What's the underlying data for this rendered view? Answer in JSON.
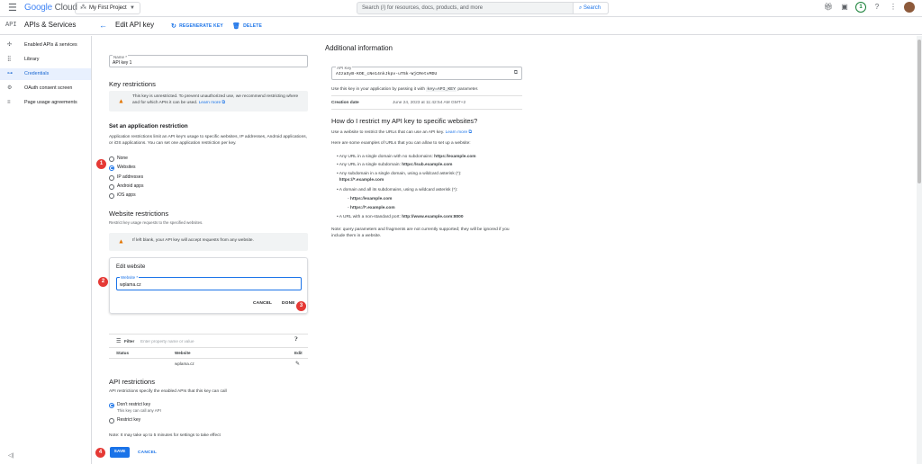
{
  "topbar": {
    "logo_google": "Google",
    "logo_cloud": "Cloud",
    "project": "My First Project",
    "search_placeholder": "Search (/) for resources, docs, products, and more",
    "search_button": "Search",
    "badge": "1"
  },
  "subbar": {
    "api_mark": "API",
    "section": "APIs & Services",
    "title": "Edit API key",
    "regenerate": "REGENERATE KEY",
    "delete": "DELETE"
  },
  "sidebar": {
    "items": [
      {
        "icon": "✣",
        "label": "Enabled APIs & services"
      },
      {
        "icon": "⣿",
        "label": "Library"
      },
      {
        "icon": "⊶",
        "label": "Credentials"
      },
      {
        "icon": "⚙",
        "label": "OAuth consent screen"
      },
      {
        "icon": "≡",
        "label": "Page usage agreements"
      }
    ],
    "collapse": "◁|"
  },
  "form": {
    "name_label": "Name *",
    "name_value": "API key 1",
    "key_restrictions": "Key restrictions",
    "unrestricted_warning": "This key is unrestricted. To prevent unauthorized use, we recommend restricting where and for which APIs it can be used.",
    "learn_more": "Learn more",
    "app_restriction_title": "Set an application restriction",
    "app_restriction_desc": "Application restrictions limit an API key's usage to specific websites, IP addresses, Android applications, or iOS applications. You can set one application restriction per key.",
    "options": [
      "None",
      "Websites",
      "IP addresses",
      "Android apps",
      "iOS apps"
    ],
    "selected_option": "Websites",
    "website_restrictions_title": "Website restrictions",
    "website_restrictions_desc": "Restrict key usage requests to the specified websites.",
    "blank_warning": "If left blank, your API key will accept requests from any website.",
    "edit_website": "Edit website",
    "website_label": "Website *",
    "website_value": "wplama.cz",
    "cancel": "CANCEL",
    "done": "DONE",
    "filter_label": "Filter",
    "filter_placeholder": "Enter property name or value",
    "col_status": "Status",
    "col_website": "Website",
    "col_edit": "Edit",
    "row_website": "wplama.cz",
    "api_restrictions_title": "API restrictions",
    "api_restrictions_desc": "API restrictions specify the enabled APIs that this key can call",
    "dont_restrict": "Don't restrict key",
    "dont_restrict_sub": "This key can call any API",
    "restrict": "Restrict key",
    "note": "Note: It may take up to 5 minutes for settings to take effect",
    "save": "SAVE",
    "cancel_bottom": "CANCEL"
  },
  "markers": [
    "1",
    "2",
    "3",
    "4"
  ],
  "info": {
    "title": "Additional information",
    "api_key_label": "API Key",
    "api_key_value": "AIzaSyB-KOE_cNe14nkJkpv-uT5k-WjCRetvMDU",
    "usage_prefix": "Use this key in your application by passing it with",
    "usage_code": "key=API_KEY",
    "usage_suffix": "parameter.",
    "creation_label": "Creation date",
    "creation_value": "June 24, 2023 at 11:42:54 AM GMT+2",
    "how_title": "How do I restrict my API key to specific websites?",
    "how_desc": "Use a website to restrict the URLs that can use an API key.",
    "learn_more": "Learn more",
    "examples_intro": "Here are some examples of URLs that you can allow to set up a website:",
    "b1_text": "Any URL in a single domain with no subdomains:",
    "b1_url": "https://example.com",
    "b2_text": "Any URL in a single subdomain:",
    "b2_url": "https://sub.example.com",
    "b3_text": "Any subdomain in a single domain, using a wildcard asterisk (*):",
    "b3_url": "https://*.example.com",
    "b4_text": "A domain and all its subdomains, using a wildcard asterisk (*):",
    "b4_sub1": "https://example.com",
    "b4_sub2": "https://*.example.com",
    "b5_text": "A URL with a non-standard port:",
    "b5_url": "http://www.example.com:8000",
    "note": "Note: query parameters and fragments are not currently supported; they will be ignored if you include them in a website."
  }
}
